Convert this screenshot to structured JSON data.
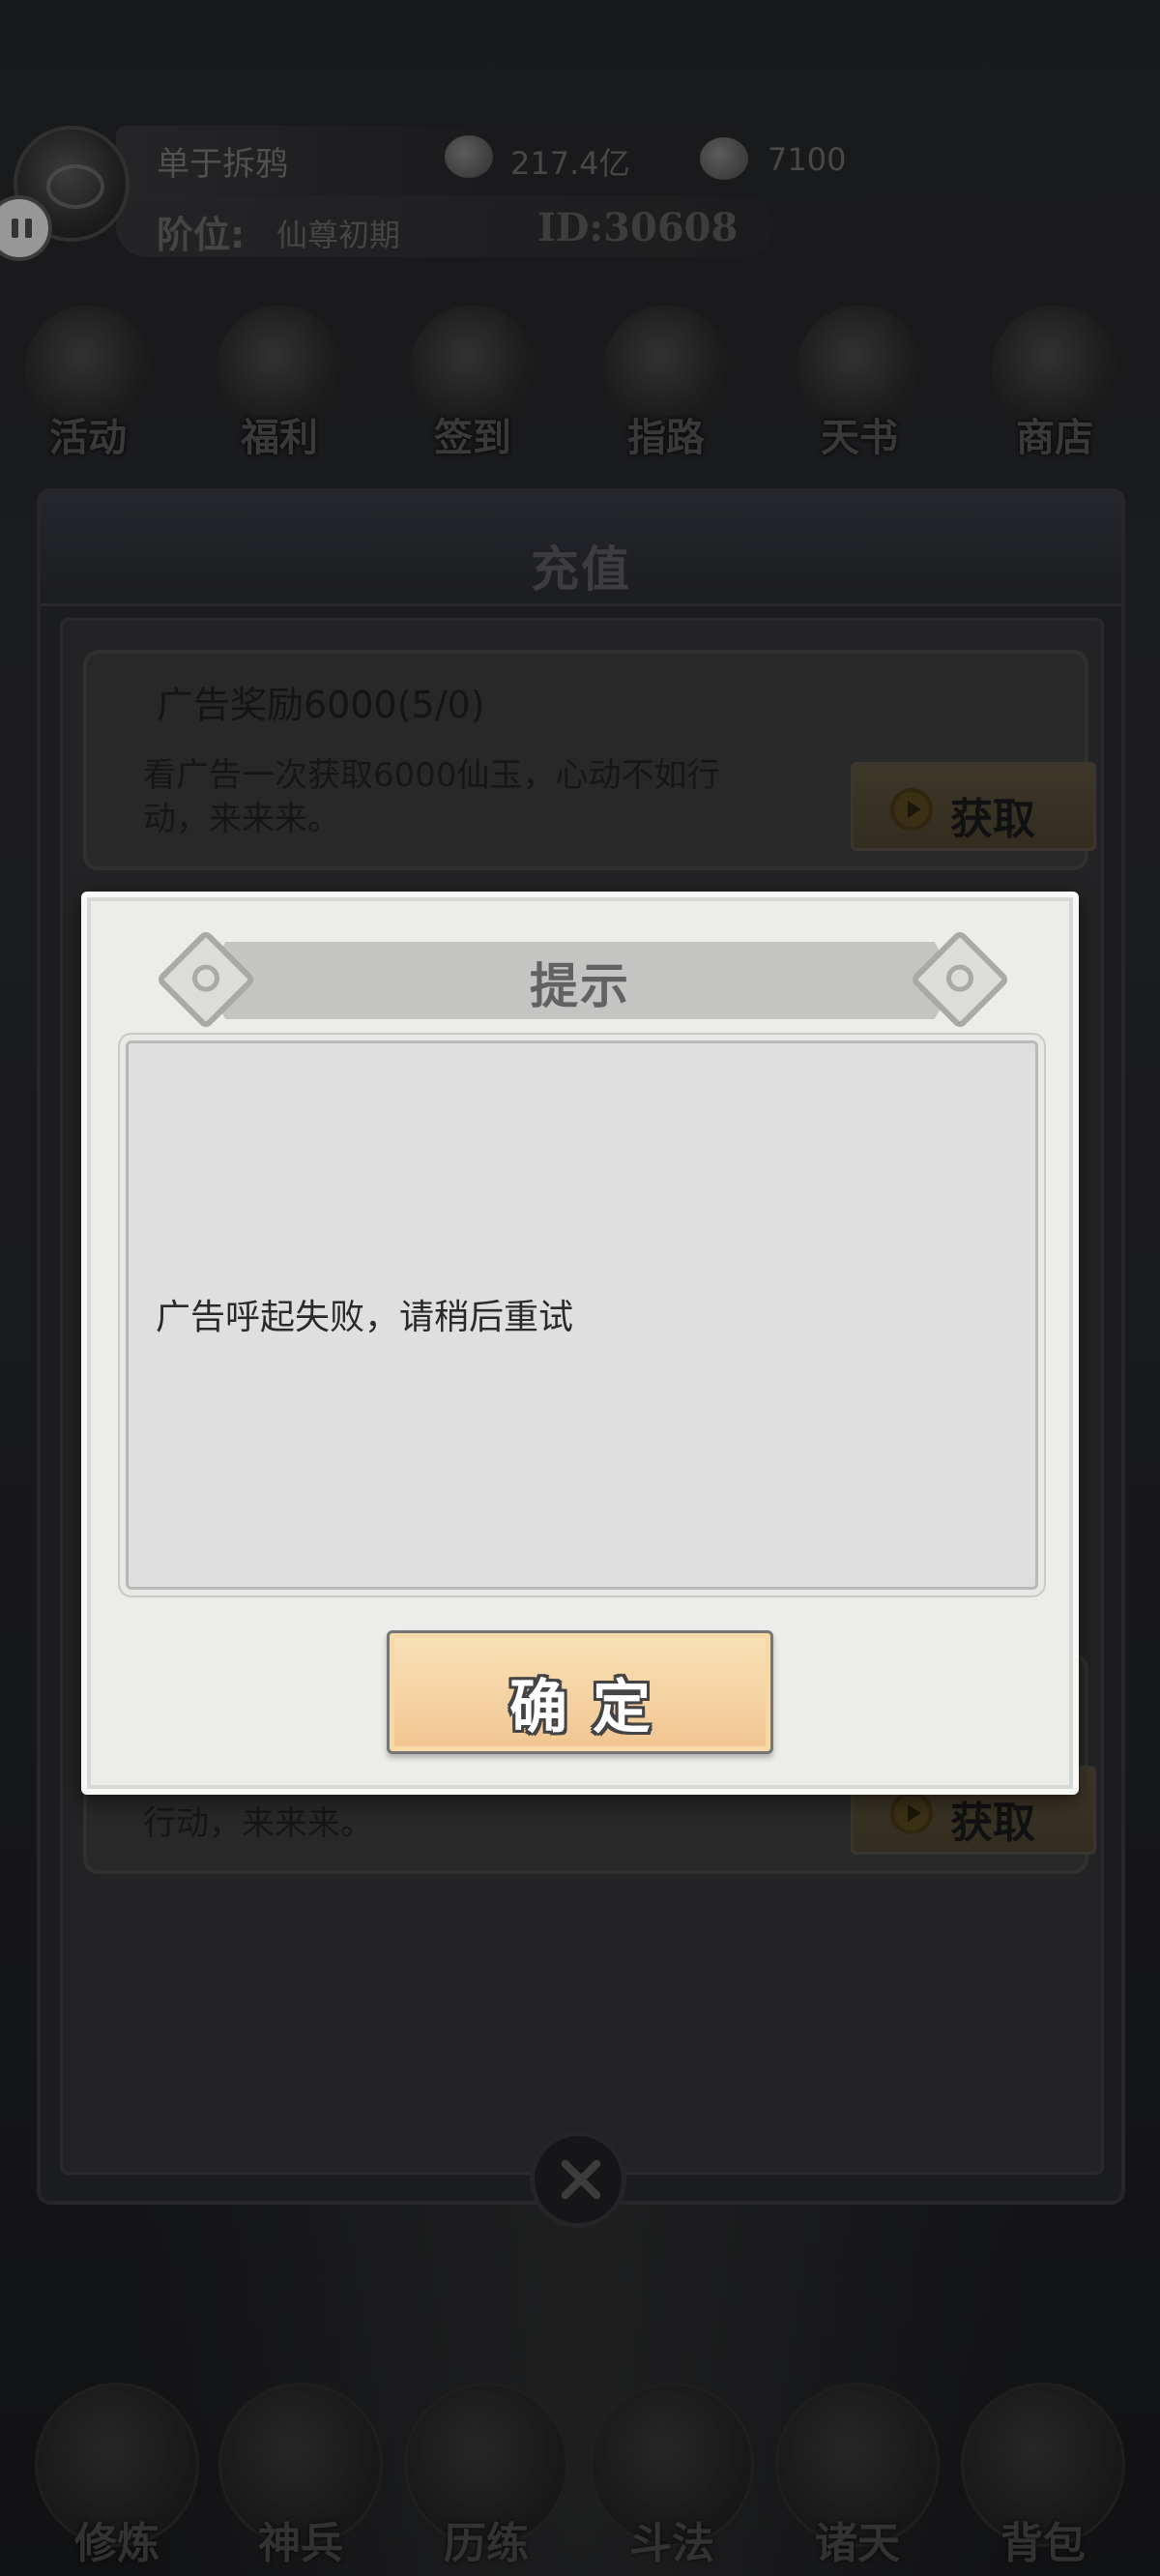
{
  "player": {
    "name": "单于拆鸦",
    "rank_label": "阶位:",
    "rank_value": "仙尊初期",
    "id": "ID:30608",
    "currency_1": "217.4亿",
    "currency_2": "7100"
  },
  "top_nav": [
    {
      "label": "活动",
      "icon": "event-icon"
    },
    {
      "label": "福利",
      "icon": "welfare-icon"
    },
    {
      "label": "签到",
      "icon": "signin-icon"
    },
    {
      "label": "指路",
      "icon": "guide-icon"
    },
    {
      "label": "天书",
      "icon": "book-icon"
    },
    {
      "label": "商店",
      "icon": "shop-icon"
    }
  ],
  "panel": {
    "title": "充值",
    "cards": [
      {
        "title": "广告奖励6000(5/0)",
        "description": "看广告一次获取6000仙玉，心动不如行动，来来来。",
        "button": "获取"
      },
      {
        "title": "",
        "description": "行动，来来来。",
        "button": "获取"
      }
    ]
  },
  "dialog": {
    "title": "提示",
    "message": "广告呼起失败，请稍后重试",
    "confirm": "确定"
  },
  "bottom_nav": [
    {
      "label": "修炼",
      "icon": "cultivate-icon"
    },
    {
      "label": "神兵",
      "icon": "weapon-icon"
    },
    {
      "label": "历练",
      "icon": "training-icon"
    },
    {
      "label": "斗法",
      "icon": "duel-icon"
    },
    {
      "label": "诸天",
      "icon": "heavens-icon"
    },
    {
      "label": "背包",
      "icon": "bag-icon"
    }
  ]
}
